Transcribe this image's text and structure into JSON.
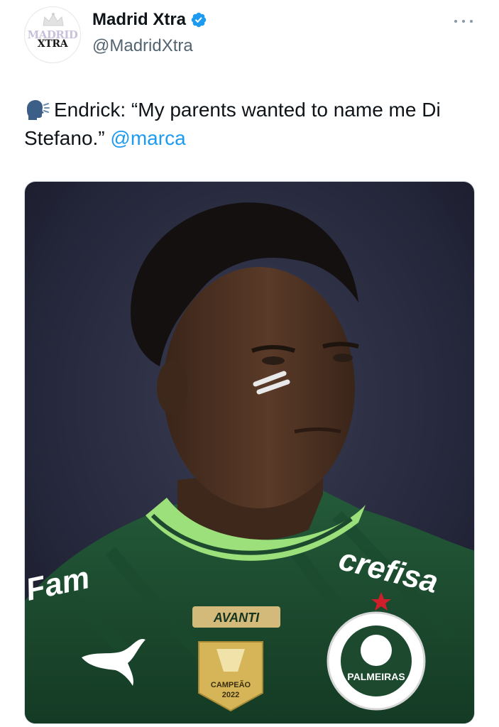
{
  "account": {
    "display_name": "Madrid Xtra",
    "handle": "@MadridXtra",
    "verified": true,
    "avatar_text_top": "MADRID",
    "avatar_text_bottom": "XTRA"
  },
  "tweet": {
    "icon": "speaking-head-icon",
    "text": "Endrick: “My parents wanted to name me Di Stefano.”",
    "mention": "@marca"
  },
  "photo": {
    "jersey_sponsor": "crefisa",
    "jersey_sleeve_text": "Fam",
    "jersey_patch": "AVANTI",
    "badge_text": "CAMPEÃO",
    "badge_year": "2022",
    "club_crest": "PALMEIRAS",
    "brand_logo": "puma-logo"
  },
  "colors": {
    "verified_blue": "#1d9bf0",
    "mention_blue": "#1d9bf0",
    "jersey_green": "#1d4a2f",
    "collar_green": "#9be07a"
  }
}
